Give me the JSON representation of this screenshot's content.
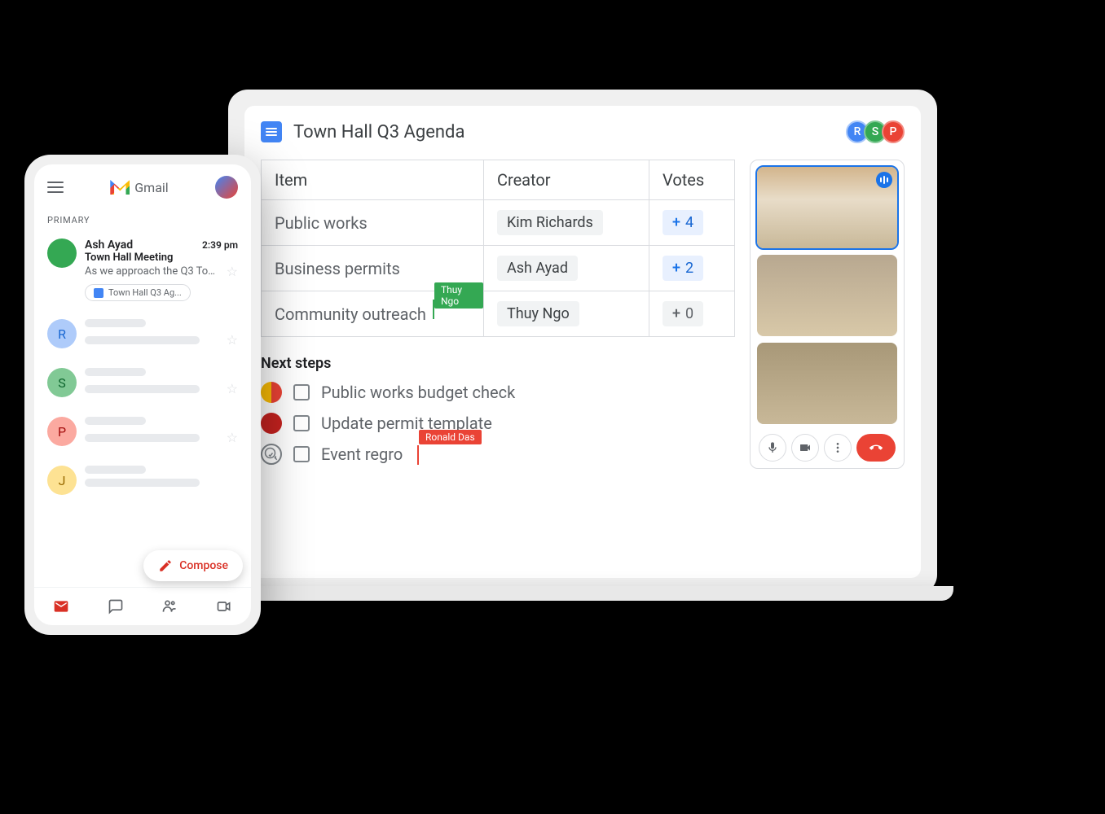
{
  "docs": {
    "title": "Town Hall Q3 Agenda",
    "collaborators": [
      {
        "initial": "R"
      },
      {
        "initial": "S"
      },
      {
        "initial": "P"
      }
    ],
    "table": {
      "headers": {
        "item": "Item",
        "creator": "Creator",
        "votes": "Votes"
      },
      "rows": [
        {
          "item": "Public works",
          "creator": "Kim Richards",
          "votes": "4"
        },
        {
          "item": "Business permits",
          "creator": "Ash Ayad",
          "votes": "2"
        },
        {
          "item": "Community outreach",
          "creator": "Thuy Ngo",
          "votes": "0"
        }
      ]
    },
    "cursors": {
      "green": "Thuy Ngo",
      "red": "Ronald Das"
    },
    "next_steps": {
      "title": "Next steps",
      "items": [
        {
          "text": "Public works budget check"
        },
        {
          "text": "Update permit template"
        },
        {
          "text": "Event regro"
        }
      ]
    }
  },
  "gmail": {
    "brand": "Gmail",
    "primary_label": "PRIMARY",
    "compose_label": "Compose",
    "email": {
      "sender": "Ash Ayad",
      "time": "2:39 pm",
      "subject": "Town Hall Meeting",
      "preview": "As we approach the Q3 Town Ha...",
      "attachment": "Town Hall Q3 Ag..."
    },
    "placeholder_avatars": [
      "R",
      "S",
      "P",
      "J"
    ],
    "colors": {
      "r": "#aecbfa",
      "s": "#81c995",
      "p": "#fba9a0",
      "j": "#fde293"
    }
  }
}
